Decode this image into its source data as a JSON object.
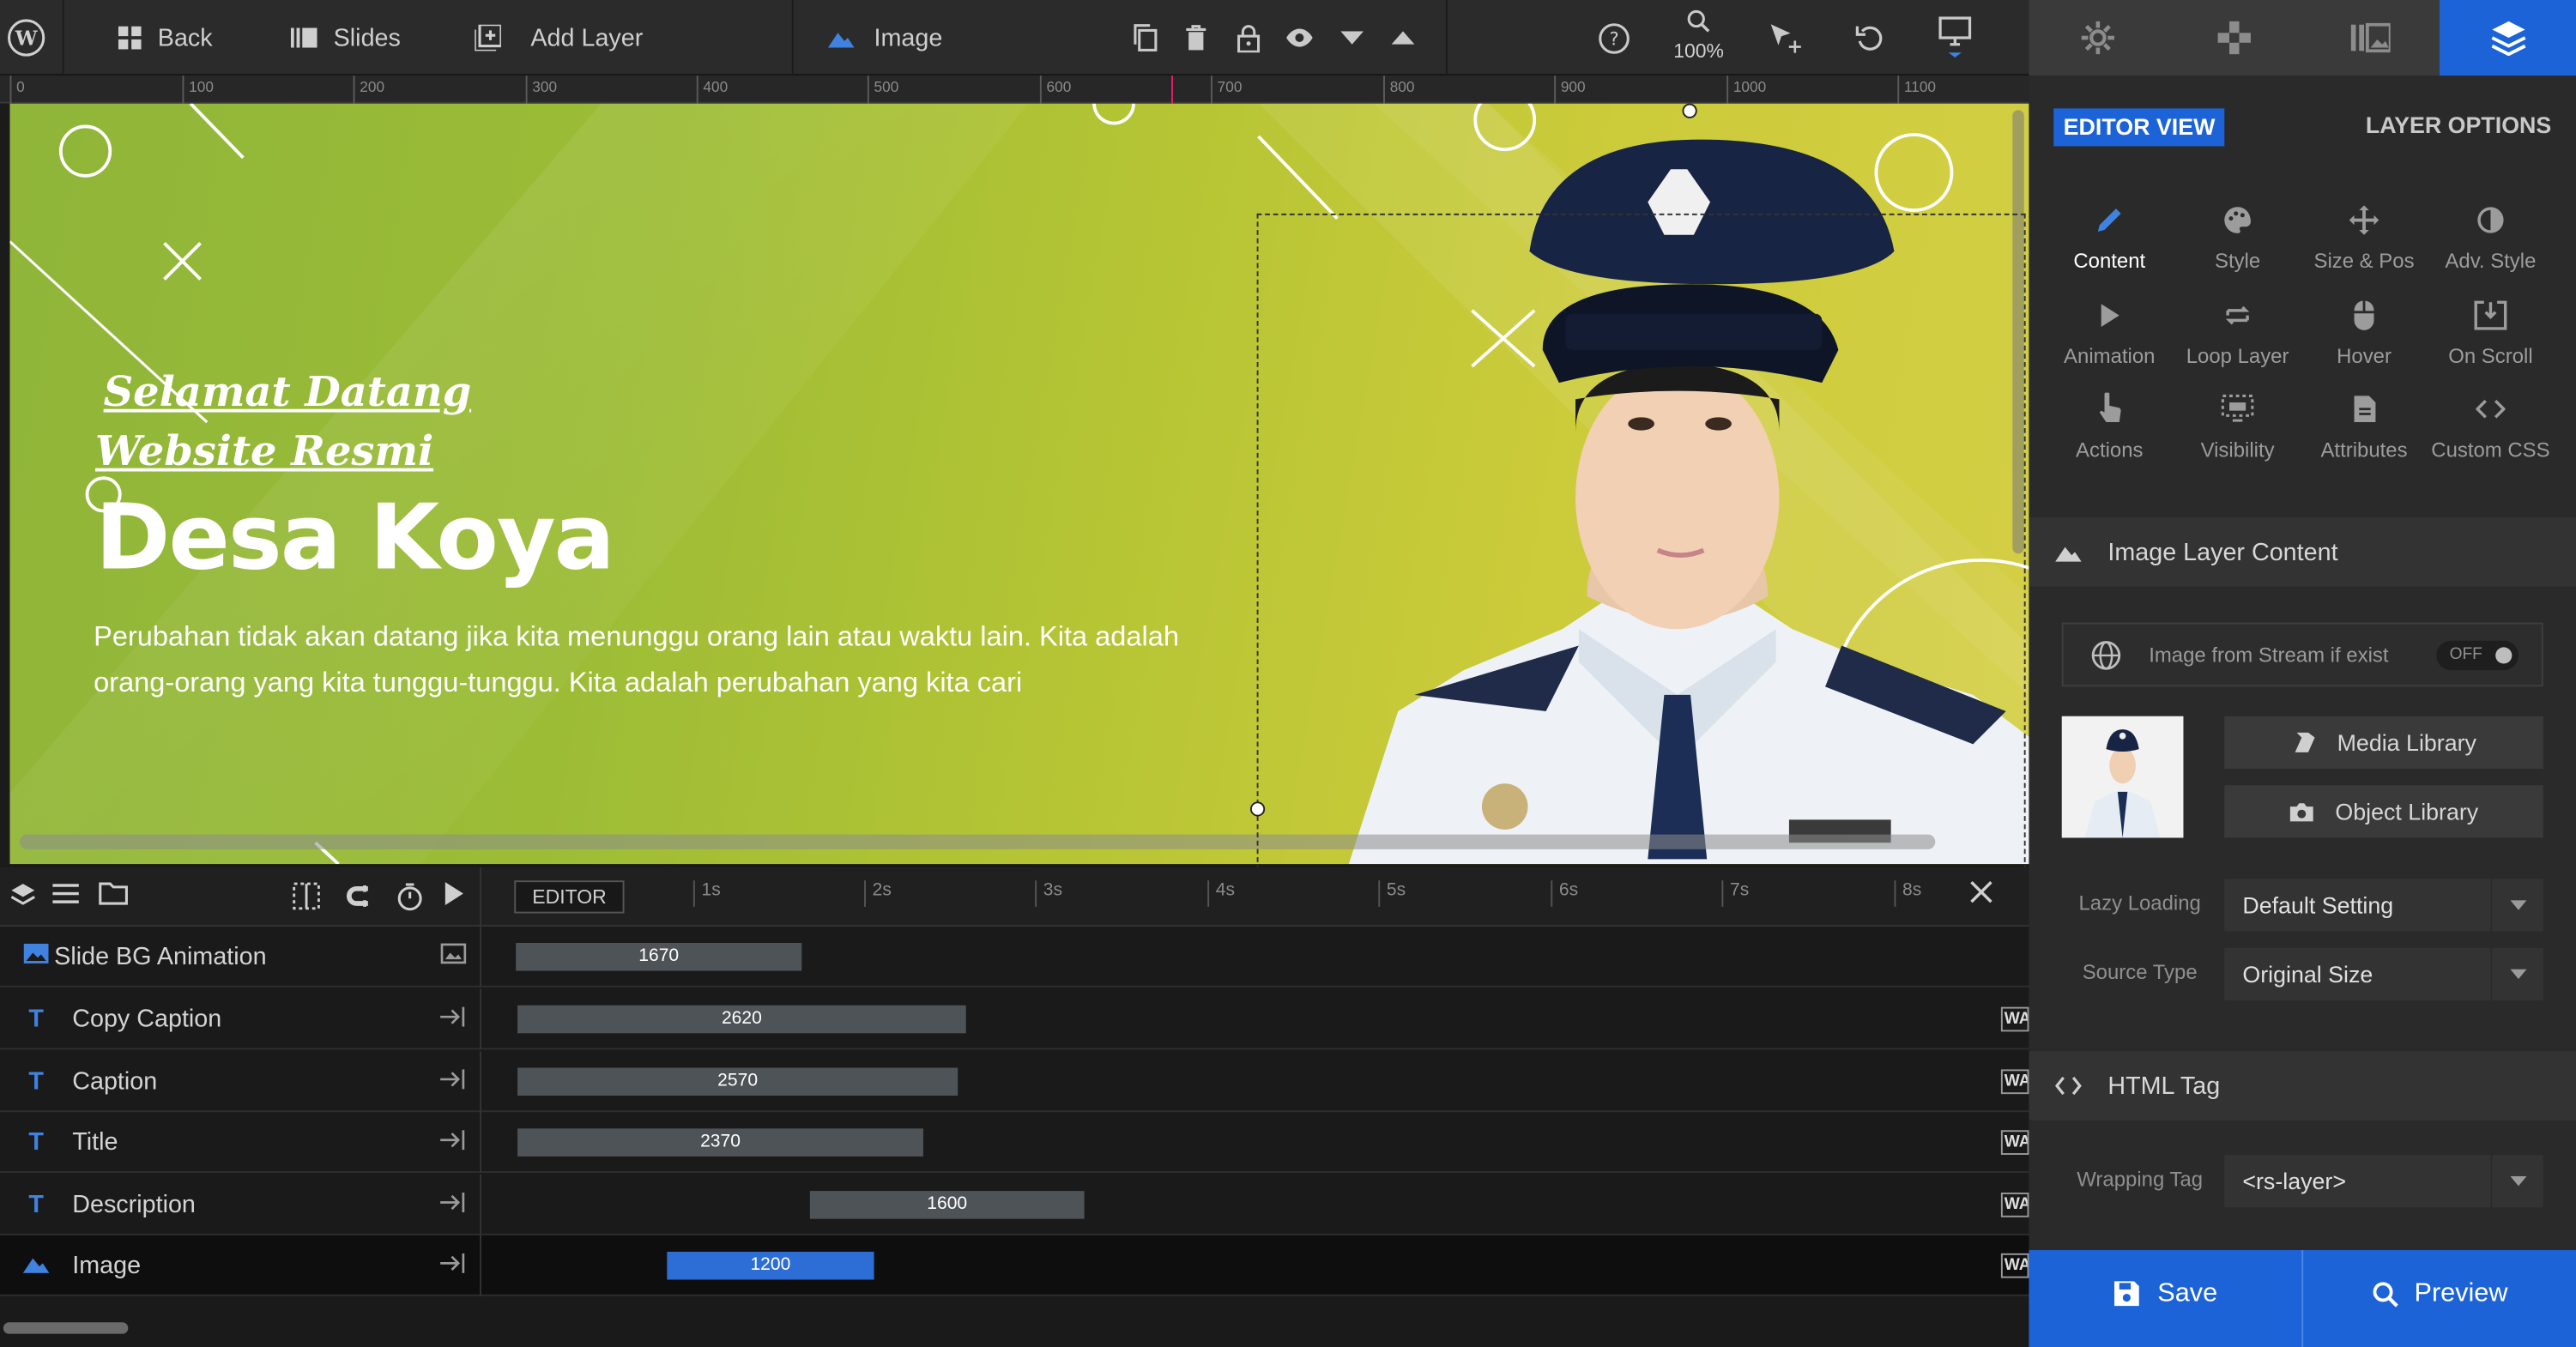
{
  "toolbar": {
    "back_label": "Back",
    "slides_label": "Slides",
    "add_layer_label": "Add Layer",
    "layer_type_label": "Image",
    "zoom_label": "100%"
  },
  "ruler": {
    "ticks": [
      "0",
      "100",
      "200",
      "300",
      "400",
      "500",
      "600",
      "700",
      "800",
      "900",
      "1000",
      "1100"
    ]
  },
  "slide": {
    "caption_line1": "Selamat Datang",
    "caption_line2": "Website Resmi",
    "title": "Desa Koya",
    "description": "Perubahan tidak akan datang jika kita menunggu orang lain atau waktu lain. Kita adalah orang-orang yang kita tunggu-tunggu. Kita adalah perubahan yang kita cari",
    "colors": {
      "accent_green": "#9cbc36",
      "accent_yellow": "#d4cf45"
    }
  },
  "timeline": {
    "editor_label": "EDITOR",
    "seconds": [
      "1s",
      "2s",
      "3s",
      "4s",
      "5s",
      "6s",
      "7s",
      "8s"
    ],
    "layers": [
      {
        "name": "Slide BG Animation",
        "icon": "image-icon",
        "duration": "1670"
      },
      {
        "name": "Copy Caption",
        "icon": "text-icon",
        "duration": "2620",
        "end_badge": "WA"
      },
      {
        "name": "Caption",
        "icon": "text-icon",
        "duration": "2570",
        "end_badge": "WA"
      },
      {
        "name": "Title",
        "icon": "text-icon",
        "duration": "2370",
        "end_badge": "WA"
      },
      {
        "name": "Description",
        "icon": "text-icon",
        "duration": "1600",
        "end_badge": "WA"
      },
      {
        "name": "Image",
        "icon": "mountain-icon",
        "duration": "1200",
        "end_badge": "WA"
      }
    ]
  },
  "panel": {
    "editor_view_label": "EDITOR VIEW",
    "layer_options_label": "LAYER OPTIONS",
    "options": [
      {
        "label": "Content",
        "icon": "pencil-icon"
      },
      {
        "label": "Style",
        "icon": "palette-icon"
      },
      {
        "label": "Size & Pos",
        "icon": "move-icon"
      },
      {
        "label": "Adv. Style",
        "icon": "contrast-icon"
      },
      {
        "label": "Animation",
        "icon": "play-icon"
      },
      {
        "label": "Loop Layer",
        "icon": "loop-icon"
      },
      {
        "label": "Hover",
        "icon": "mouse-icon"
      },
      {
        "label": "On Scroll",
        "icon": "scroll-icon"
      },
      {
        "label": "Actions",
        "icon": "hand-icon"
      },
      {
        "label": "Visibility",
        "icon": "visibility-icon"
      },
      {
        "label": "Attributes",
        "icon": "document-icon"
      },
      {
        "label": "Custom CSS",
        "icon": "code-icon"
      }
    ],
    "image_section_title": "Image Layer Content",
    "stream_label": "Image from Stream if exist",
    "stream_toggle": "OFF",
    "media_library_label": "Media Library",
    "object_library_label": "Object Library",
    "lazy_loading_label": "Lazy Loading",
    "lazy_loading_value": "Default Setting",
    "source_type_label": "Source Type",
    "source_type_value": "Original Size",
    "html_tag_title": "HTML Tag",
    "wrapping_tag_label": "Wrapping Tag",
    "wrapping_tag_value": "<rs-layer>",
    "save_label": "Save",
    "preview_label": "Preview",
    "accent_color": "#1d63d8"
  }
}
